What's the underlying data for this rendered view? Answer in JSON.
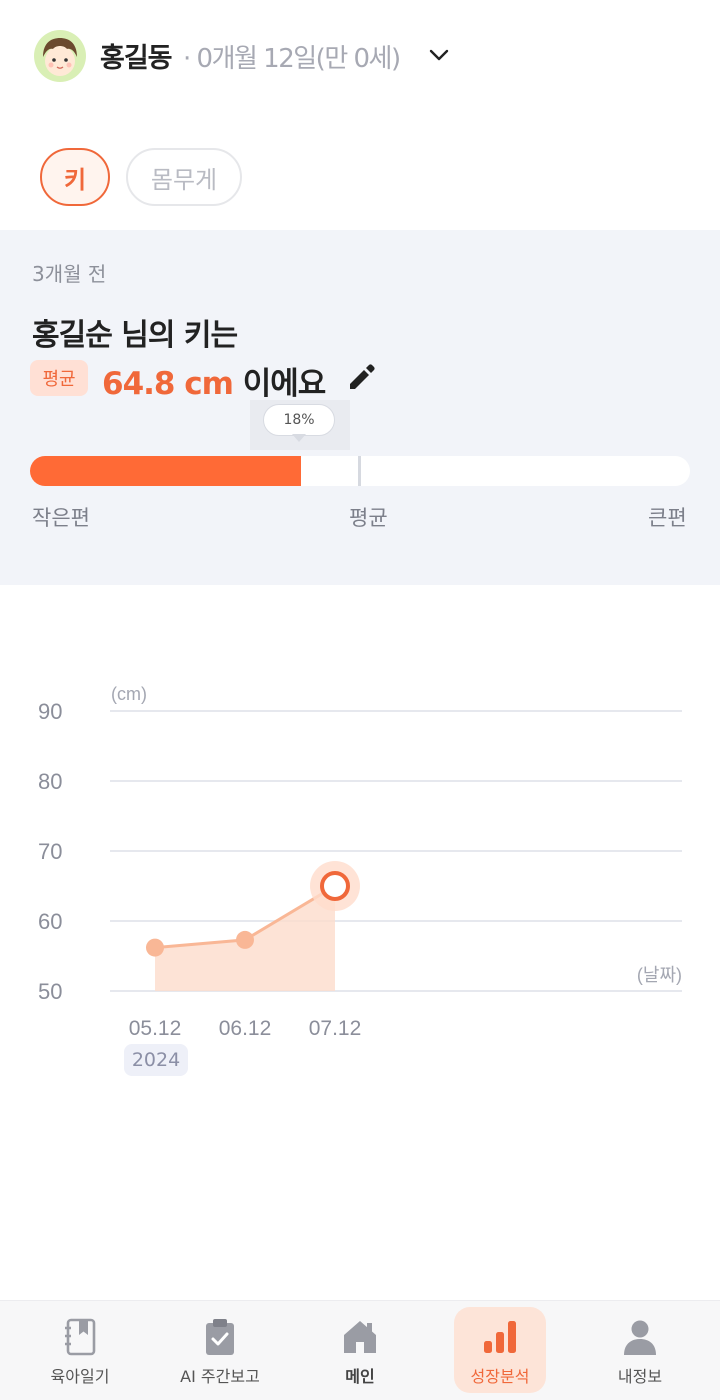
{
  "header": {
    "child_name": "홍길동",
    "child_age": "· 0개월 12일(만 0세)"
  },
  "tabs": [
    {
      "label": "키",
      "active": true
    },
    {
      "label": "몸무게",
      "active": false
    }
  ],
  "summary": {
    "period": "3개월 전",
    "headline": "홍길순 님의 키는",
    "badge": "평균",
    "value": "64.8 cm",
    "value_suffix": " 이에요",
    "percentile_label": "18%",
    "percentile": 0.41,
    "scale_small": "작은편",
    "scale_average": "평균",
    "scale_large": "큰편"
  },
  "chart_data": {
    "type": "area",
    "ylabel": "(cm)",
    "xlabel": "(날짜)",
    "ylim": [
      50,
      90
    ],
    "yticks": [
      90,
      80,
      70,
      60,
      50
    ],
    "categories": [
      "05.12",
      "06.12",
      "07.12"
    ],
    "values": [
      56.2,
      57.3,
      65
    ],
    "year_label": "2024",
    "highlight_index": 2,
    "colors": {
      "accent": "#f0683a",
      "area": "#fddccc",
      "point": "#f9b796"
    }
  },
  "bottom_nav": [
    {
      "label": "육아일기",
      "icon": "diary-icon"
    },
    {
      "label": "AI 주간보고",
      "icon": "clipboard-check-icon"
    },
    {
      "label": "메인",
      "icon": "home-icon"
    },
    {
      "label": "성장분석",
      "icon": "bar-chart-icon",
      "active": true
    },
    {
      "label": "내정보",
      "icon": "person-icon"
    }
  ]
}
